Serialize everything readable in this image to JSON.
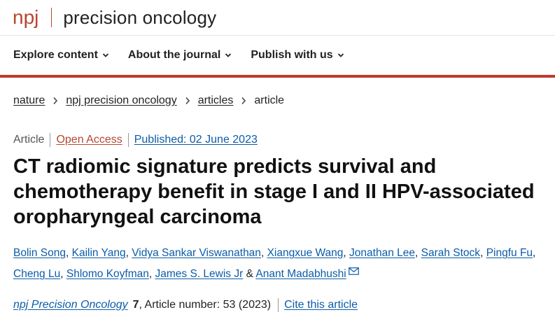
{
  "brand": {
    "npj": "npj",
    "journal": "precision oncology"
  },
  "nav": [
    {
      "label": "Explore content"
    },
    {
      "label": "About the journal"
    },
    {
      "label": "Publish with us"
    }
  ],
  "breadcrumb": [
    {
      "label": "nature"
    },
    {
      "label": "npj precision oncology"
    },
    {
      "label": "articles"
    },
    {
      "label": "article"
    }
  ],
  "meta": {
    "type": "Article",
    "access": "Open Access",
    "published": "Published: 02 June 2023"
  },
  "title": "CT radiomic signature predicts survival and chemotherapy benefit in stage I and II HPV-associated oropharyngeal carcinoma",
  "authors": [
    "Bolin Song",
    "Kailin Yang",
    "Vidya Sankar Viswanathan",
    "Xiangxue Wang",
    "Jonathan Lee",
    "Sarah Stock",
    "Pingfu Fu",
    "Cheng Lu",
    "Shlomo Koyfman",
    "James S. Lewis Jr",
    "Anant Madabhushi"
  ],
  "author_separators": {
    "comma": ",",
    "and": "&"
  },
  "citation": {
    "journal": "npj Precision Oncology",
    "volume": "7",
    "rest": ", Article number: 53 (2023)",
    "cite_link": "Cite this article"
  },
  "colors": {
    "brand": "#b8462f",
    "nav_rule": "#c0392b",
    "link": "#0b5ca8"
  },
  "icons": {
    "nav_chevron": "chevron-down-icon",
    "breadcrumb_separator": "chevron-right-icon",
    "corresponding_author": "mail-icon"
  }
}
